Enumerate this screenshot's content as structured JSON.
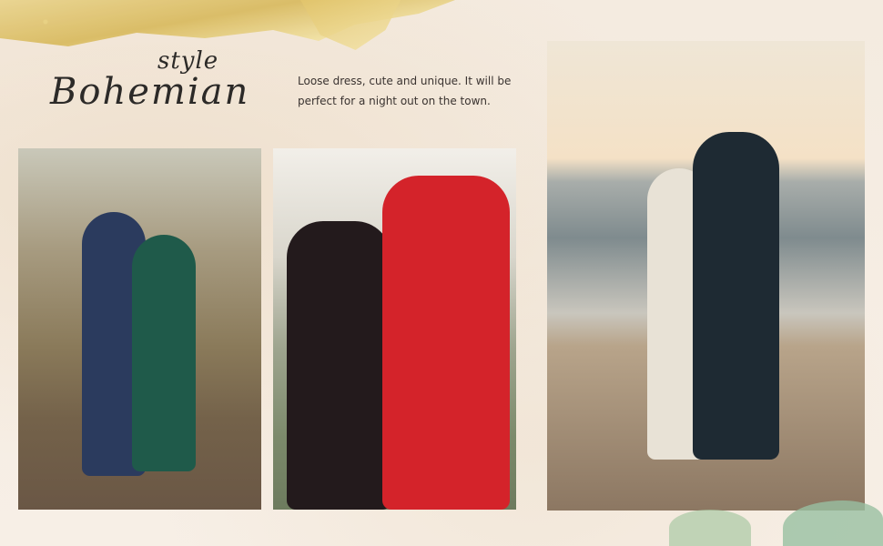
{
  "heading": {
    "small": "style",
    "big": "Bohemian"
  },
  "description": "Loose dress, cute and unique. It will be perfect for a night out on the town.",
  "photos": [
    {
      "name": "couple-in-woods"
    },
    {
      "name": "couple-at-gate"
    },
    {
      "name": "couple-on-beach"
    }
  ]
}
